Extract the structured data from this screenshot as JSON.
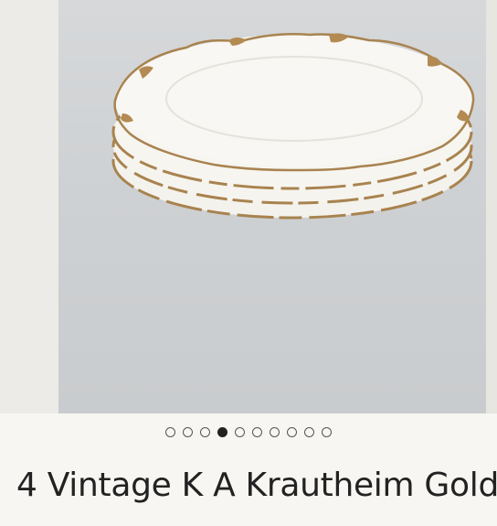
{
  "listing": {
    "title": "4 Vintage K A Krautheim Gold"
  },
  "gallery": {
    "image_name": "stacked-plates-photo",
    "image_count": 10,
    "active_index": 3
  },
  "colors": {
    "active_dot": "#222222",
    "inactive_dot_border": "#555555",
    "gold_trim": "#a8834f"
  }
}
